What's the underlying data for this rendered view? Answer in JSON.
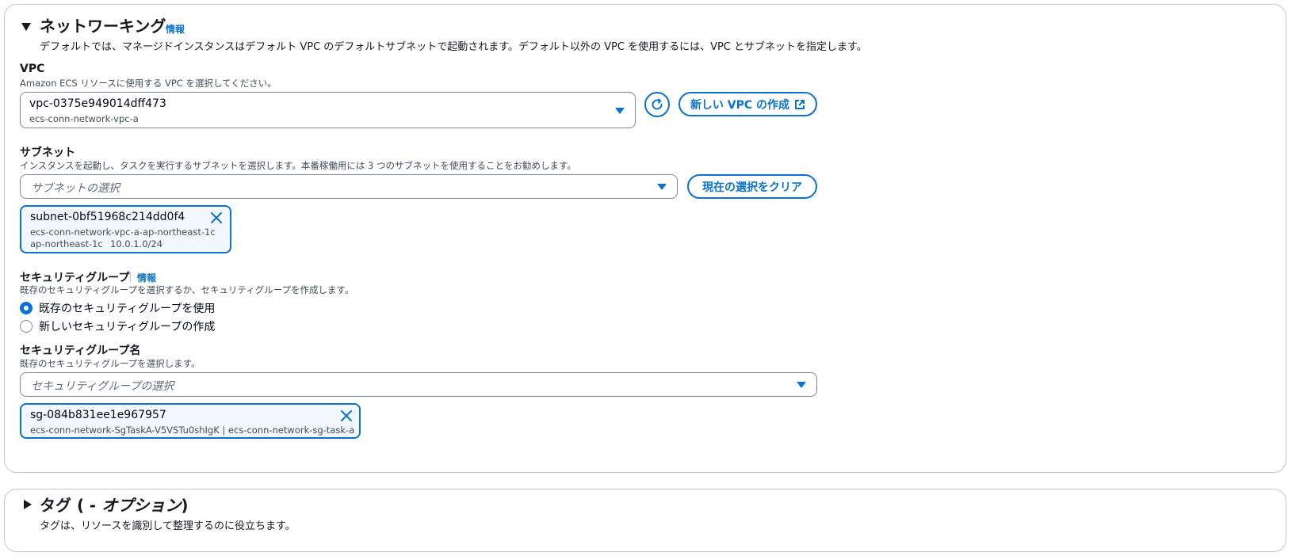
{
  "networking": {
    "title": "ネットワーキング",
    "info": "情報",
    "description": "デフォルトでは、マネージドインスタンスはデフォルト VPC のデフォルトサブネットで起動されます。デフォルト以外の VPC を使用するには、VPC とサブネットを指定します。",
    "vpc": {
      "label": "VPC",
      "description": "Amazon ECS リソースに使用する VPC を選択してください。",
      "selected_id": "vpc-0375e949014dff473",
      "selected_name": "ecs-conn-network-vpc-a",
      "refresh_icon": "refresh-icon",
      "create_button": "新しい VPC の作成",
      "external_icon": "external-link-icon"
    },
    "subnet": {
      "label": "サブネット",
      "description": "インスタンスを起動し、タスクを実行するサブネットを選択します。本番稼働用には 3 つのサブネットを使用することをお勧めします。",
      "placeholder": "サブネットの選択",
      "clear_button": "現在の選択をクリア",
      "token": {
        "id": "subnet-0bf51968c214dd0f4",
        "name": "ecs-conn-network-vpc-a-ap-northeast-1c",
        "az": "ap-northeast-1c",
        "cidr": "10.0.1.0/24"
      }
    },
    "security_group": {
      "label": "セキュリティグループ",
      "info": "情報",
      "description": "既存のセキュリティグループを選択するか、セキュリティグループを作成します。",
      "option_existing": "既存のセキュリティグループを使用",
      "option_new": "新しいセキュリティグループの作成",
      "selected_option": "existing"
    },
    "security_group_name": {
      "label": "セキュリティグループ名",
      "description": "既存のセキュリティグループを選択します。",
      "placeholder": "セキュリティグループの選択",
      "token": {
        "id": "sg-084b831ee1e967957",
        "detail": "ecs-conn-network-SgTaskA-V5VSTu0shIgK | ecs-conn-network-sg-task-a"
      }
    }
  },
  "tags": {
    "title_prefix": "タグ (",
    "title_italic": " - オプション",
    "title_suffix": ")",
    "description": "タグは、リソースを識別して整理するのに役立ちます。"
  },
  "colors": {
    "accent": "#0972d3",
    "border": "#c6c6cd",
    "token_bg": "#f2f8fd"
  }
}
